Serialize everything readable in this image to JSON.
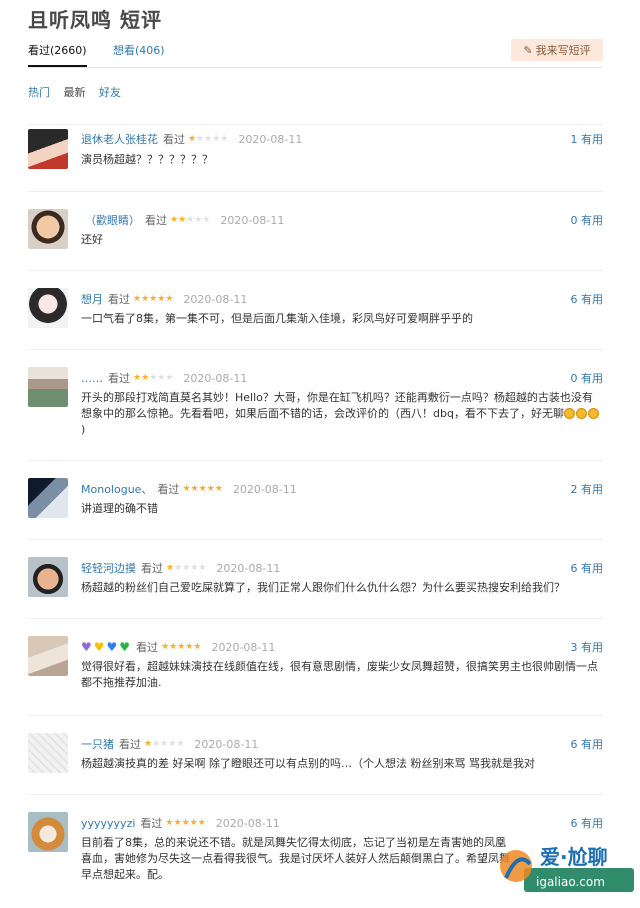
{
  "page": {
    "title": "且听凤鸣 短评"
  },
  "tabs": {
    "watched": "看过(2660)",
    "wish": "想看(406)",
    "write_button": "我来写短评"
  },
  "sort": {
    "hot": "热门",
    "latest": "最新",
    "friends": "好友"
  },
  "vote_suffix": "有用",
  "comments": [
    {
      "user": "退休老人张桂花",
      "status": "看过",
      "rating": 1,
      "date": "2020-08-11",
      "votes": "1",
      "text": "演员杨超越？？？？？？？"
    },
    {
      "user": "（歡眼睛）",
      "status": "看过",
      "rating": 2,
      "date": "2020-08-11",
      "votes": "0",
      "text": "还好"
    },
    {
      "user": "想月",
      "status": "看过",
      "rating": 5,
      "date": "2020-08-11",
      "votes": "6",
      "text": "一口气看了8集，第一集不可，但是后面几集渐入佳境，彩凤鸟好可爱啊胖乎乎的"
    },
    {
      "user": "……",
      "status": "看过",
      "rating": 2,
      "date": "2020-08-11",
      "votes": "0",
      "text": "开头的那段打戏简直莫名其妙！Hello？大哥，你是在缸飞机吗？还能再敷衍一点吗？杨超越的古装也没有想象中的那么惊艳。先看看吧，如果后面不错的话，会改评价的（西八！dbq，看不下去了，好无聊"
    },
    {
      "user": "Monologue、",
      "status": "看过",
      "rating": 5,
      "date": "2020-08-11",
      "votes": "2",
      "text": "讲道理的确不错"
    },
    {
      "user": "轻轻河边摸",
      "status": "看过",
      "rating": 1,
      "date": "2020-08-11",
      "votes": "6",
      "text": "杨超越的粉丝们自己爱吃屎就算了，我们正常人跟你们什么仇什么怨？为什么要买热搜安利给我们？"
    },
    {
      "user": "",
      "status": "看过",
      "rating": 5,
      "date": "2020-08-11",
      "votes": "3",
      "text": "觉得很好看，超越妹妹演技在线颜值在线，很有意思剧情，废柴少女凤舞超赞，很搞笑男主也很帅剧情一点都不拖推荐加油."
    },
    {
      "user": "一只猪",
      "status": "看过",
      "rating": 1,
      "date": "2020-08-11",
      "votes": "6",
      "text": "杨超越演技真的差 好呆啊 除了瞪眼还可以有点别的吗…（个人想法 粉丝别来骂 骂我就是我对"
    },
    {
      "user": "yyyyyyyzi",
      "status": "看过",
      "rating": 5,
      "date": "2020-08-11",
      "votes": "6",
      "text": "目前看了8集，总的来说还不错。就是凤舞失忆得太彻底，忘记了当初是左青害她的凤凰喜血，害她修为尽失这一点看得我很气。我是讨厌坏人装好人然后颠倒黑白了。希望凤舞早点想起来。配。"
    }
  ],
  "watermark": {
    "text": "爱·尬聊",
    "url": "igaliao.com"
  },
  "colors": {
    "link": "#3377aa",
    "star": "#ffac2d",
    "tab_btn_bg": "#fce9dc"
  }
}
